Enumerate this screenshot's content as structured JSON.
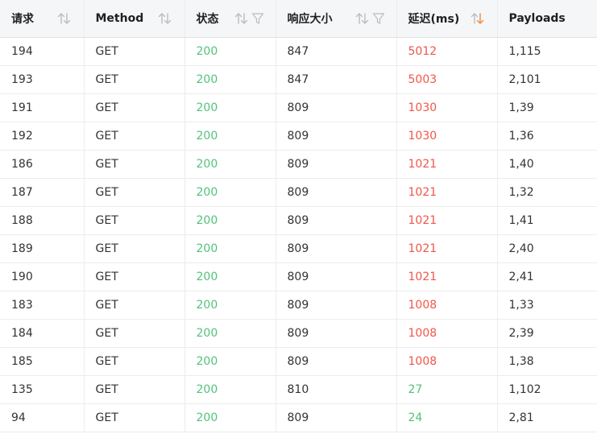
{
  "columns": [
    {
      "label": "请求",
      "sortable": true,
      "filterable": false,
      "sort": "none"
    },
    {
      "label": "Method",
      "sortable": true,
      "filterable": false,
      "sort": "none"
    },
    {
      "label": "状态",
      "sortable": true,
      "filterable": true,
      "sort": "none"
    },
    {
      "label": "响应大小",
      "sortable": true,
      "filterable": true,
      "sort": "none"
    },
    {
      "label": "延迟(ms)",
      "sortable": true,
      "filterable": false,
      "sort": "desc"
    },
    {
      "label": "Payloads",
      "sortable": false,
      "filterable": false,
      "sort": "none"
    }
  ],
  "rows": [
    {
      "request": "194",
      "method": "GET",
      "status": "200",
      "size": "847",
      "latency": "5012",
      "latency_level": "slow",
      "payloads": "1,115"
    },
    {
      "request": "193",
      "method": "GET",
      "status": "200",
      "size": "847",
      "latency": "5003",
      "latency_level": "slow",
      "payloads": "2,101"
    },
    {
      "request": "191",
      "method": "GET",
      "status": "200",
      "size": "809",
      "latency": "1030",
      "latency_level": "slow",
      "payloads": "1,39"
    },
    {
      "request": "192",
      "method": "GET",
      "status": "200",
      "size": "809",
      "latency": "1030",
      "latency_level": "slow",
      "payloads": "1,36"
    },
    {
      "request": "186",
      "method": "GET",
      "status": "200",
      "size": "809",
      "latency": "1021",
      "latency_level": "slow",
      "payloads": "1,40"
    },
    {
      "request": "187",
      "method": "GET",
      "status": "200",
      "size": "809",
      "latency": "1021",
      "latency_level": "slow",
      "payloads": "1,32"
    },
    {
      "request": "188",
      "method": "GET",
      "status": "200",
      "size": "809",
      "latency": "1021",
      "latency_level": "slow",
      "payloads": "1,41"
    },
    {
      "request": "189",
      "method": "GET",
      "status": "200",
      "size": "809",
      "latency": "1021",
      "latency_level": "slow",
      "payloads": "2,40"
    },
    {
      "request": "190",
      "method": "GET",
      "status": "200",
      "size": "809",
      "latency": "1021",
      "latency_level": "slow",
      "payloads": "2,41"
    },
    {
      "request": "183",
      "method": "GET",
      "status": "200",
      "size": "809",
      "latency": "1008",
      "latency_level": "slow",
      "payloads": "1,33"
    },
    {
      "request": "184",
      "method": "GET",
      "status": "200",
      "size": "809",
      "latency": "1008",
      "latency_level": "slow",
      "payloads": "2,39"
    },
    {
      "request": "185",
      "method": "GET",
      "status": "200",
      "size": "809",
      "latency": "1008",
      "latency_level": "slow",
      "payloads": "1,38"
    },
    {
      "request": "135",
      "method": "GET",
      "status": "200",
      "size": "810",
      "latency": "27",
      "latency_level": "fast",
      "payloads": "1,102"
    },
    {
      "request": "94",
      "method": "GET",
      "status": "200",
      "size": "809",
      "latency": "24",
      "latency_level": "fast",
      "payloads": "2,81"
    }
  ],
  "colors": {
    "status_ok": "#52c27a",
    "latency_slow": "#f0564a",
    "latency_fast": "#52c27a",
    "sort_active": "#f08a3c",
    "sort_inactive": "#b9bcc2"
  },
  "icons": {
    "sort": "sort-arrows-icon",
    "filter": "filter-funnel-icon"
  }
}
